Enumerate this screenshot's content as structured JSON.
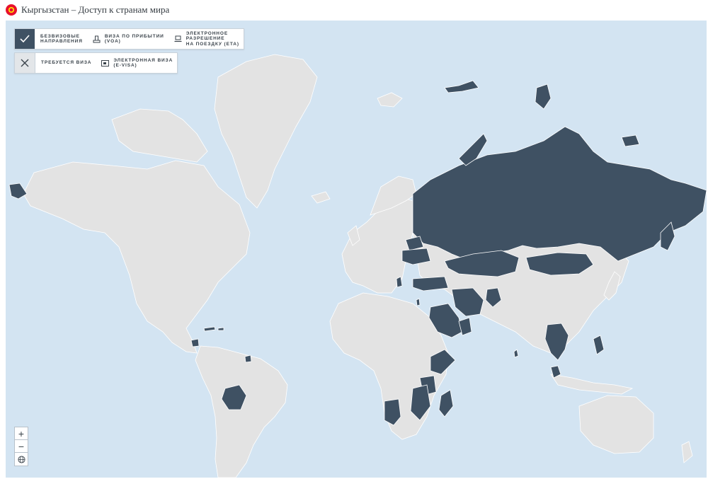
{
  "header": {
    "title": "Кыргызстан – Доступ к странам мира"
  },
  "colors": {
    "ocean": "#d3e4f2",
    "land_other": "#e3e3e3",
    "visa_free": "#3f5163",
    "border": "#ffffff"
  },
  "legend": {
    "row1": [
      {
        "icon": "check-icon",
        "label": "Безвизовые\nнаправления"
      },
      {
        "icon": "stamp-icon",
        "label": "Виза по прибытии\n(VOA)"
      },
      {
        "icon": "laptop-icon",
        "label": "Электронное\nразрешение\nна поездку (ETA)"
      }
    ],
    "row2": [
      {
        "icon": "close-icon",
        "label": "Требуется виза"
      },
      {
        "icon": "evisa-card-icon",
        "label": "Электронная виза\n(E-VISA)"
      }
    ]
  },
  "zoom": {
    "in": "+",
    "out": "−"
  }
}
